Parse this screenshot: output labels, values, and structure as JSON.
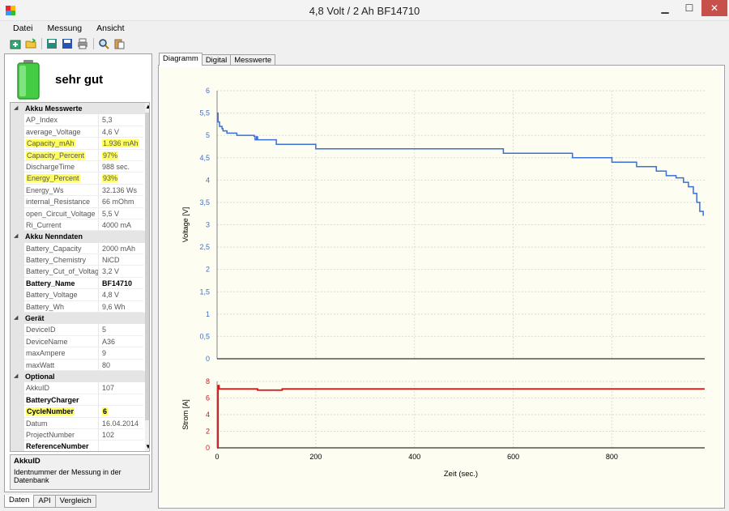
{
  "window": {
    "title": "4,8 Volt / 2 Ah  BF14710",
    "minimize": "▁",
    "maximize": "☐",
    "close": "✕"
  },
  "menu": [
    "Datei",
    "Messung",
    "Ansicht"
  ],
  "toolbar_icons": [
    "add-icon",
    "open-folder-icon",
    "save-green-icon",
    "save-icon",
    "print-icon",
    "search-icon",
    "clipboard-icon"
  ],
  "status": {
    "text": "sehr gut",
    "icon": "battery-full-icon"
  },
  "property_grid": {
    "categories": [
      {
        "name": "Akku Messwerte",
        "rows": [
          {
            "name": "AP_Index",
            "value": "5,3"
          },
          {
            "name": "average_Voltage",
            "value": "4,6 V"
          },
          {
            "name": "Capacity_mAh",
            "value": "1.936 mAh",
            "highlight": true
          },
          {
            "name": "Capacity_Percent",
            "value": "97%",
            "highlight": true
          },
          {
            "name": "DischargeTime",
            "value": "988 sec."
          },
          {
            "name": "Energy_Percent",
            "value": "93%",
            "highlight": true
          },
          {
            "name": "Energy_Ws",
            "value": "32.136 Ws"
          },
          {
            "name": "internal_Resistance",
            "value": "66 mOhm"
          },
          {
            "name": "open_Circuit_Voltage",
            "value": "5,5 V"
          },
          {
            "name": "Ri_Current",
            "value": "4000 mA"
          }
        ]
      },
      {
        "name": "Akku Nenndaten",
        "rows": [
          {
            "name": "Battery_Capacity",
            "value": "2000 mAh"
          },
          {
            "name": "Battery_Chemistry",
            "value": "NiCD"
          },
          {
            "name": "Battery_Cut_of_Voltage",
            "value": "3,2 V"
          },
          {
            "name": "Battery_Name",
            "value": "BF14710",
            "bold": true
          },
          {
            "name": "Battery_Voltage",
            "value": "4,8 V"
          },
          {
            "name": "Battery_Wh",
            "value": "9,6 Wh"
          }
        ]
      },
      {
        "name": "Gerät",
        "rows": [
          {
            "name": "DeviceID",
            "value": "5"
          },
          {
            "name": "DeviceName",
            "value": "A36"
          },
          {
            "name": "maxAmpere",
            "value": "9"
          },
          {
            "name": "maxWatt",
            "value": "80"
          }
        ]
      },
      {
        "name": "Optional",
        "rows": [
          {
            "name": "AkkuID",
            "value": "107"
          },
          {
            "name": "BatteryCharger",
            "value": "",
            "bold": true
          },
          {
            "name": "CycleNumber",
            "value": "6",
            "highlight": true,
            "bold": true
          },
          {
            "name": "Datum",
            "value": "16.04.2014"
          },
          {
            "name": "ProjectNumber",
            "value": "102"
          },
          {
            "name": "ReferenceNumber",
            "value": "",
            "bold": true
          }
        ]
      }
    ]
  },
  "description": {
    "title": "AkkuID",
    "text": "Identnummer der Messung in der Datenbank"
  },
  "bottom_tabs": [
    "Daten",
    "API",
    "Vergleich"
  ],
  "top_tabs": [
    "Diagramm",
    "Digital",
    "Messwerte"
  ],
  "colors": {
    "voltage": "#3a6fd8",
    "current": "#e01010",
    "highlight": "#ffff60"
  },
  "chart_data": [
    {
      "type": "line",
      "ylabel": "Voltage [V]",
      "ylim": [
        0,
        6
      ],
      "yticks": [
        "0",
        "0,5",
        "1",
        "1,5",
        "2",
        "2,5",
        "3",
        "3,5",
        "4",
        "4,5",
        "5",
        "5,5",
        "6"
      ],
      "grid": true,
      "x": [
        0,
        2,
        5,
        10,
        12,
        20,
        40,
        75,
        77,
        80,
        82,
        120,
        200,
        580,
        720,
        800,
        830,
        850,
        870,
        890,
        910,
        930,
        945,
        955,
        965,
        972,
        978,
        985
      ],
      "values": [
        5.5,
        5.3,
        5.2,
        5.15,
        5.1,
        5.05,
        5.0,
        4.98,
        4.9,
        4.97,
        4.9,
        4.8,
        4.7,
        4.6,
        4.5,
        4.4,
        4.4,
        4.3,
        4.3,
        4.2,
        4.1,
        4.05,
        3.95,
        3.85,
        3.7,
        3.5,
        3.3,
        3.2
      ]
    },
    {
      "type": "line",
      "xlabel": "Zeit (sec.)",
      "ylabel": "Strom [A]",
      "xlim": [
        0,
        988
      ],
      "ylim": [
        0,
        8
      ],
      "xticks": [
        "0",
        "200",
        "400",
        "600",
        "800"
      ],
      "yticks": [
        "0",
        "2",
        "4",
        "6",
        "8"
      ],
      "grid": true,
      "x": [
        0,
        2,
        4,
        8,
        80,
        82,
        130,
        132,
        988
      ],
      "values": [
        0,
        7.5,
        7.1,
        7.1,
        7.1,
        6.95,
        6.95,
        7.1,
        7.1
      ]
    }
  ]
}
